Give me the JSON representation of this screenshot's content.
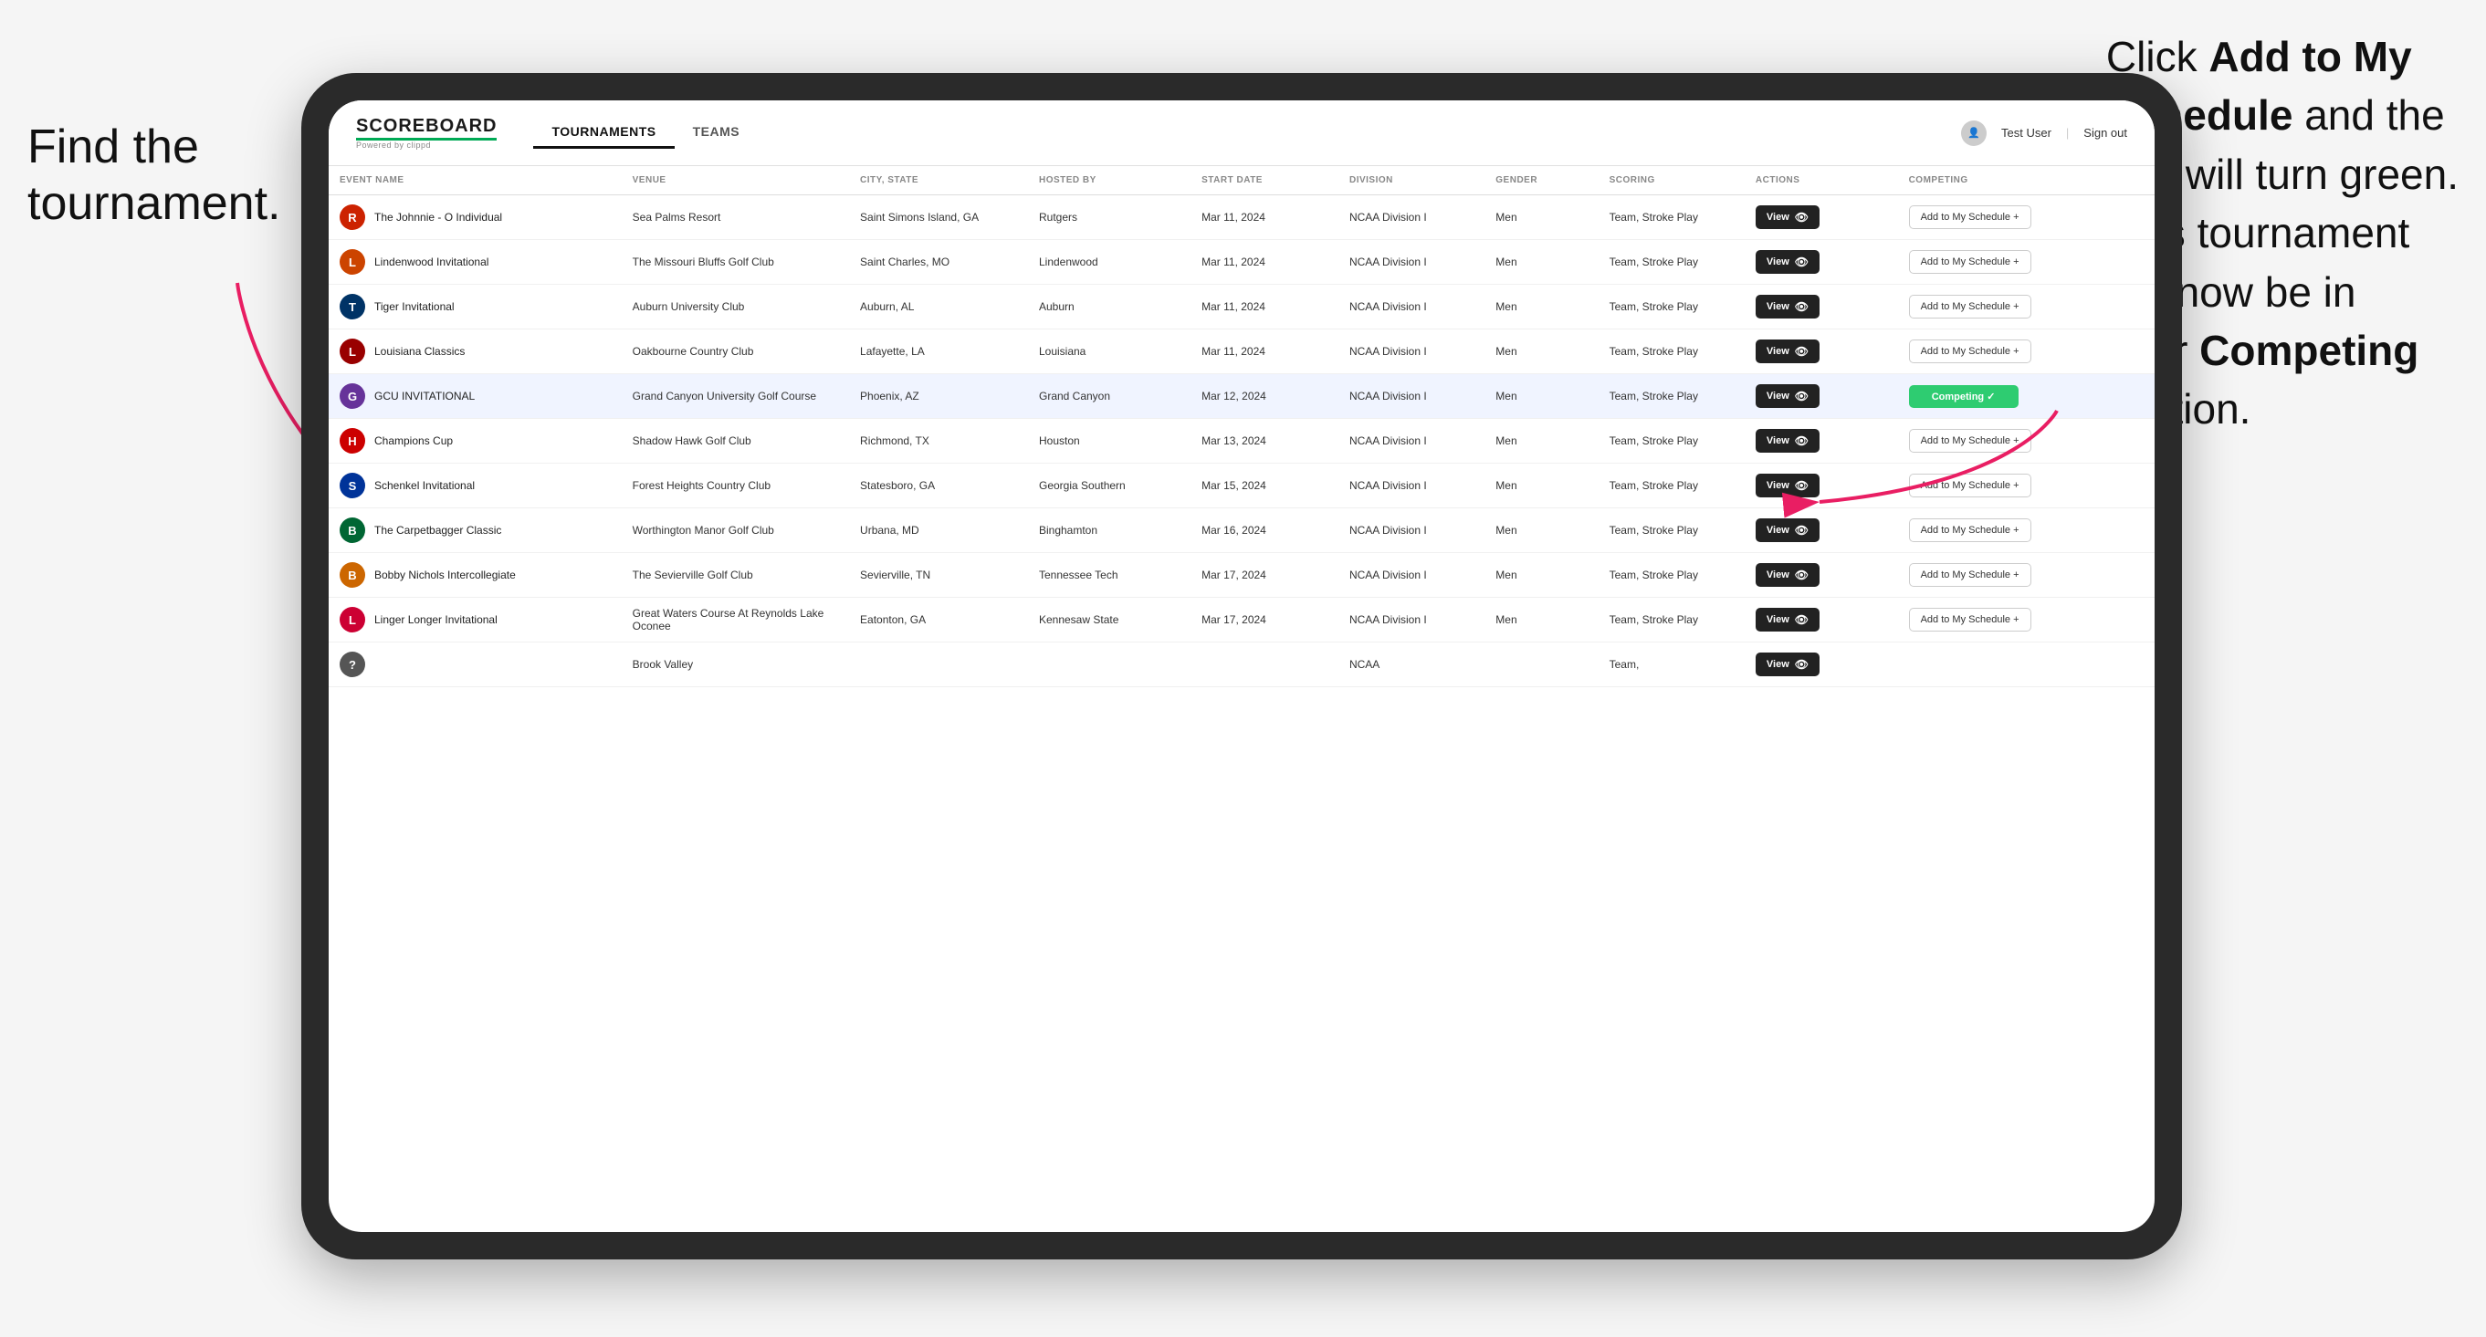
{
  "annotations": {
    "left": "Find the\ntournament.",
    "right_line1": "Click ",
    "right_bold1": "Add to My\nSchedule",
    "right_line2": " and the\nbox will turn green.\nThis tournament\nwill now be in\nyour ",
    "right_bold2": "Competing",
    "right_line3": "\nsection."
  },
  "header": {
    "logo": "SCOREBOARD",
    "logo_sub": "Powered by clippd",
    "nav_tabs": [
      "TOURNAMENTS",
      "TEAMS"
    ],
    "active_tab": "TOURNAMENTS",
    "user": "Test User",
    "sign_out": "Sign out"
  },
  "table": {
    "columns": [
      "EVENT NAME",
      "VENUE",
      "CITY, STATE",
      "HOSTED BY",
      "START DATE",
      "DIVISION",
      "GENDER",
      "SCORING",
      "ACTIONS",
      "COMPETING"
    ],
    "rows": [
      {
        "id": 1,
        "logo_color": "#cc2200",
        "logo_letter": "R",
        "event_name": "The Johnnie - O Individual",
        "venue": "Sea Palms Resort",
        "city_state": "Saint Simons Island, GA",
        "hosted_by": "Rutgers",
        "start_date": "Mar 11, 2024",
        "division": "NCAA Division I",
        "gender": "Men",
        "scoring": "Team, Stroke Play",
        "action": "View",
        "competing": "Add to My Schedule",
        "is_competing": false,
        "highlighted": false
      },
      {
        "id": 2,
        "logo_color": "#cc4400",
        "logo_letter": "L",
        "event_name": "Lindenwood Invitational",
        "venue": "The Missouri Bluffs Golf Club",
        "city_state": "Saint Charles, MO",
        "hosted_by": "Lindenwood",
        "start_date": "Mar 11, 2024",
        "division": "NCAA Division I",
        "gender": "Men",
        "scoring": "Team, Stroke Play",
        "action": "View",
        "competing": "Add to My Schedule",
        "is_competing": false,
        "highlighted": false
      },
      {
        "id": 3,
        "logo_color": "#003366",
        "logo_letter": "T",
        "event_name": "Tiger Invitational",
        "venue": "Auburn University Club",
        "city_state": "Auburn, AL",
        "hosted_by": "Auburn",
        "start_date": "Mar 11, 2024",
        "division": "NCAA Division I",
        "gender": "Men",
        "scoring": "Team, Stroke Play",
        "action": "View",
        "competing": "Add to My Schedule",
        "is_competing": false,
        "highlighted": false
      },
      {
        "id": 4,
        "logo_color": "#990000",
        "logo_letter": "L",
        "event_name": "Louisiana Classics",
        "venue": "Oakbourne Country Club",
        "city_state": "Lafayette, LA",
        "hosted_by": "Louisiana",
        "start_date": "Mar 11, 2024",
        "division": "NCAA Division I",
        "gender": "Men",
        "scoring": "Team, Stroke Play",
        "action": "View",
        "competing": "Add to My Schedule",
        "is_competing": false,
        "highlighted": false
      },
      {
        "id": 5,
        "logo_color": "#663399",
        "logo_letter": "G",
        "event_name": "GCU INVITATIONAL",
        "venue": "Grand Canyon University Golf Course",
        "city_state": "Phoenix, AZ",
        "hosted_by": "Grand Canyon",
        "start_date": "Mar 12, 2024",
        "division": "NCAA Division I",
        "gender": "Men",
        "scoring": "Team, Stroke Play",
        "action": "View",
        "competing": "Competing",
        "is_competing": true,
        "highlighted": true
      },
      {
        "id": 6,
        "logo_color": "#cc0000",
        "logo_letter": "H",
        "event_name": "Champions Cup",
        "venue": "Shadow Hawk Golf Club",
        "city_state": "Richmond, TX",
        "hosted_by": "Houston",
        "start_date": "Mar 13, 2024",
        "division": "NCAA Division I",
        "gender": "Men",
        "scoring": "Team, Stroke Play",
        "action": "View",
        "competing": "Add to My Schedule",
        "is_competing": false,
        "highlighted": false
      },
      {
        "id": 7,
        "logo_color": "#003399",
        "logo_letter": "S",
        "event_name": "Schenkel Invitational",
        "venue": "Forest Heights Country Club",
        "city_state": "Statesboro, GA",
        "hosted_by": "Georgia Southern",
        "start_date": "Mar 15, 2024",
        "division": "NCAA Division I",
        "gender": "Men",
        "scoring": "Team, Stroke Play",
        "action": "View",
        "competing": "Add to My Schedule",
        "is_competing": false,
        "highlighted": false
      },
      {
        "id": 8,
        "logo_color": "#006633",
        "logo_letter": "B",
        "event_name": "The Carpetbagger Classic",
        "venue": "Worthington Manor Golf Club",
        "city_state": "Urbana, MD",
        "hosted_by": "Binghamton",
        "start_date": "Mar 16, 2024",
        "division": "NCAA Division I",
        "gender": "Men",
        "scoring": "Team, Stroke Play",
        "action": "View",
        "competing": "Add to My Schedule",
        "is_competing": false,
        "highlighted": false
      },
      {
        "id": 9,
        "logo_color": "#cc6600",
        "logo_letter": "B",
        "event_name": "Bobby Nichols Intercollegiate",
        "venue": "The Sevierville Golf Club",
        "city_state": "Sevierville, TN",
        "hosted_by": "Tennessee Tech",
        "start_date": "Mar 17, 2024",
        "division": "NCAA Division I",
        "gender": "Men",
        "scoring": "Team, Stroke Play",
        "action": "View",
        "competing": "Add to My Schedule",
        "is_competing": false,
        "highlighted": false
      },
      {
        "id": 10,
        "logo_color": "#cc0033",
        "logo_letter": "L",
        "event_name": "Linger Longer Invitational",
        "venue": "Great Waters Course At Reynolds Lake Oconee",
        "city_state": "Eatonton, GA",
        "hosted_by": "Kennesaw State",
        "start_date": "Mar 17, 2024",
        "division": "NCAA Division I",
        "gender": "Men",
        "scoring": "Team, Stroke Play",
        "action": "View",
        "competing": "Add to My Schedule",
        "is_competing": false,
        "highlighted": false
      },
      {
        "id": 11,
        "logo_color": "#555555",
        "logo_letter": "?",
        "event_name": "",
        "venue": "Brook Valley",
        "city_state": "",
        "hosted_by": "",
        "start_date": "",
        "division": "NCAA",
        "gender": "",
        "scoring": "Team,",
        "action": "View",
        "competing": "",
        "is_competing": false,
        "highlighted": false
      }
    ]
  }
}
